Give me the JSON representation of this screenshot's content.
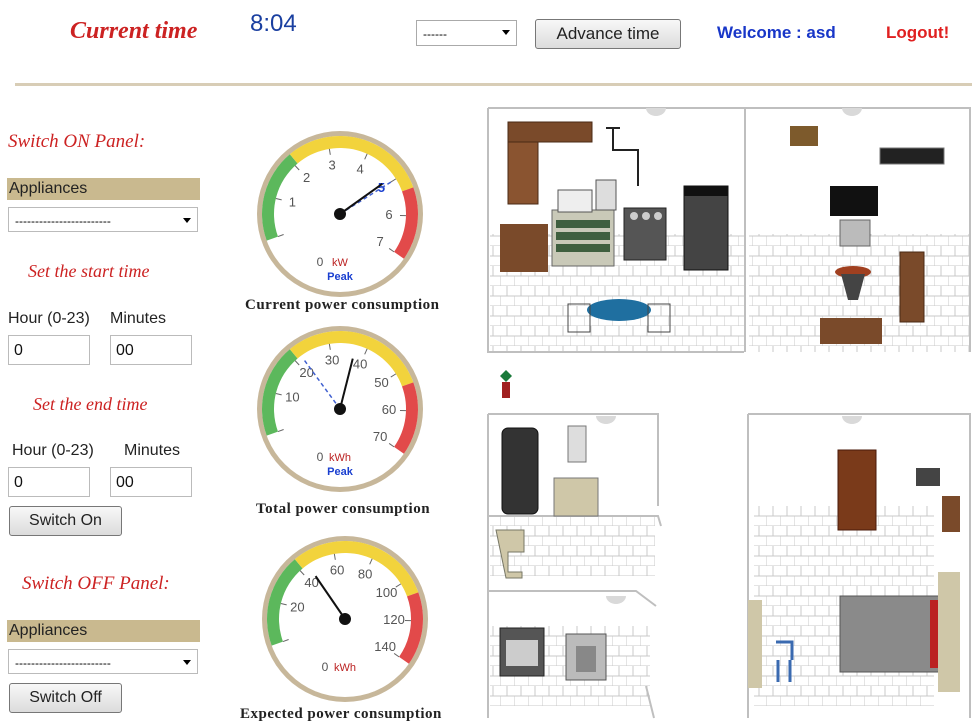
{
  "header": {
    "title": "Current time",
    "clock": "8:04",
    "time_select": "------",
    "advance_label": "Advance time",
    "welcome": "Welcome : asd",
    "logout": "Logout!"
  },
  "on_panel": {
    "heading": "Switch ON Panel:",
    "appliances_label": "Appliances",
    "appliance_select": "------------------------",
    "start_heading": "Set the start time",
    "start_hour_label": "Hour (0-23)",
    "start_min_label": "Minutes",
    "start_hour": "0",
    "start_min": "00",
    "end_heading": "Set the end time",
    "end_hour_label": "Hour (0-23)",
    "end_min_label": "Minutes",
    "end_hour": "0",
    "end_min": "00",
    "button": "Switch On"
  },
  "off_panel": {
    "heading": "Switch OFF Panel:",
    "appliances_label": "Appliances",
    "appliance_select": "------------------------",
    "button": "Switch Off"
  },
  "gauges": [
    {
      "caption": "Current power consumption",
      "unit": "kW",
      "peak": "Peak",
      "ticks": [
        "0",
        "1",
        "2",
        "3",
        "4",
        "5",
        "6",
        "7"
      ],
      "max": 7,
      "value": 4.9,
      "peak_value": 5
    },
    {
      "caption": "Total power consumption",
      "unit": "kWh",
      "peak": "Peak",
      "ticks": [
        "0",
        "10",
        "20",
        "30",
        "40",
        "50",
        "60",
        "70"
      ],
      "max": 70,
      "value": 37,
      "peak_value": 22
    },
    {
      "caption": "Expected power consumption",
      "unit": "kWh",
      "peak": "",
      "ticks": [
        "0",
        "20",
        "40",
        "60",
        "80",
        "100",
        "120",
        "140"
      ],
      "max": 140,
      "value": 45,
      "peak_value": null
    }
  ],
  "colors": {
    "green": "#5cb85c",
    "yellow": "#f2d33c",
    "red": "#e24a4a",
    "rim": "#c7b79a"
  }
}
